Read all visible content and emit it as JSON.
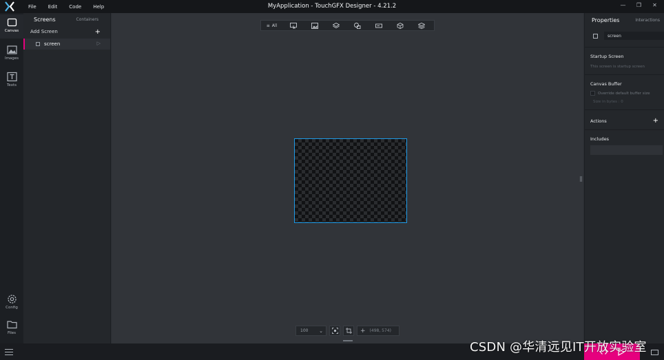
{
  "titlebar": {
    "menu": [
      "File",
      "Edit",
      "Code",
      "Help"
    ],
    "title": "MyApplication - TouchGFX Designer - 4.21.2"
  },
  "rail": {
    "items": [
      {
        "label": "Canvas",
        "icon": "canvas-icon"
      },
      {
        "label": "Images",
        "icon": "image-icon"
      },
      {
        "label": "Texts",
        "icon": "text-icon"
      },
      {
        "label": "Config",
        "icon": "gear-icon"
      },
      {
        "label": "Files",
        "icon": "folder-icon"
      }
    ]
  },
  "screens_panel": {
    "tab_screens": "Screens",
    "tab_containers": "Containers",
    "add_screen": "Add Screen",
    "add_symbol": "+",
    "screen_name": "screen",
    "selected_accent": "#e6007e"
  },
  "toolbar": {
    "all_label": "All"
  },
  "canvas": {
    "zoom": "100",
    "coords": "(498, 574)",
    "border_color": "#1e9be8"
  },
  "properties": {
    "tab_properties": "Properties",
    "tab_interactions": "Interactions",
    "name_value": "screen",
    "startup_title": "Startup Screen",
    "startup_text": "This screen is startup screen",
    "buffer_title": "Canvas Buffer",
    "override_label": "Override default buffer size",
    "size_label": "Size in bytes : 0",
    "actions_title": "Actions",
    "actions_plus": "+",
    "includes_title": "Includes"
  },
  "watermark": "CSDN @华清远见IT开放实验室"
}
